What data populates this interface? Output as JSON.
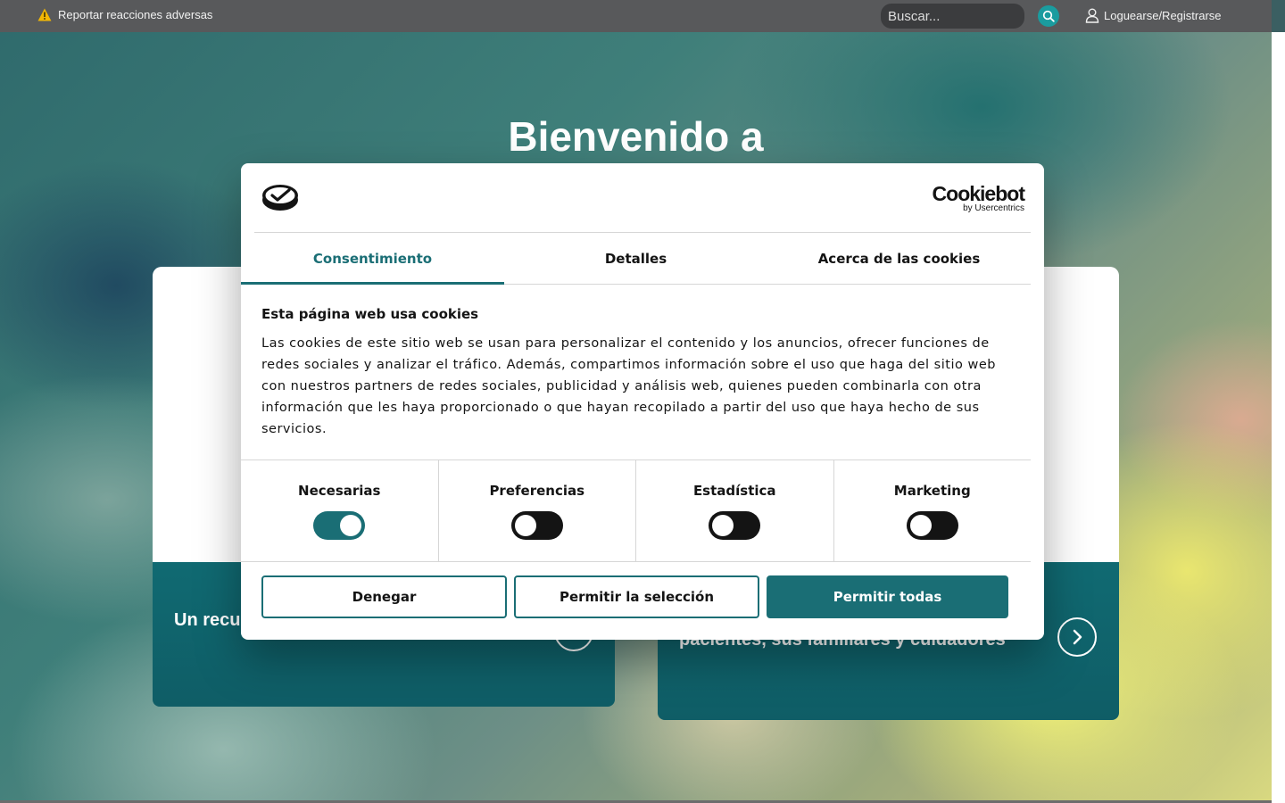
{
  "topbar": {
    "report_label": "Reportar reacciones adversas",
    "search_placeholder": "Buscar...",
    "login_label": "Loguearse/Registrarse"
  },
  "hero": {
    "title": "Bienvenido a"
  },
  "cards": {
    "left_text": "Un recurso para el Profesional Sanitario",
    "right_text": "pacientes, sus familiares y cuidadores"
  },
  "cookie_dialog": {
    "brand": {
      "name": "Cookiebot",
      "by": "by Usercentrics"
    },
    "tabs": [
      {
        "label": "Consentimiento",
        "active": true
      },
      {
        "label": "Detalles",
        "active": false
      },
      {
        "label": "Acerca de las cookies",
        "active": false
      }
    ],
    "title": "Esta página web usa cookies",
    "body": "Las cookies de este sitio web se usan para personalizar el contenido y los anuncios, ofrecer funciones de redes sociales y analizar el tráfico. Además, compartimos información sobre el uso que haga del sitio web con nuestros partners de redes sociales, publicidad y análisis web, quienes pueden combinarla con otra información que les haya proporcionado o que hayan recopilado a partir del uso que haya hecho de sus servicios.",
    "toggles": [
      {
        "label": "Necesarias",
        "on": true
      },
      {
        "label": "Preferencias",
        "on": false
      },
      {
        "label": "Estadística",
        "on": false
      },
      {
        "label": "Marketing",
        "on": false
      }
    ],
    "buttons": {
      "deny": "Denegar",
      "allow_selection": "Permitir la selección",
      "allow_all": "Permitir todas"
    }
  },
  "colors": {
    "accent": "#1a6e75",
    "topbar": "#58595b",
    "search_button": "#1a9c9f",
    "card": "#106a72"
  },
  "icons": {
    "report": "warning-triangle-icon",
    "search": "search-icon",
    "login": "user-icon",
    "card_nav": "chevron-right-icon"
  }
}
